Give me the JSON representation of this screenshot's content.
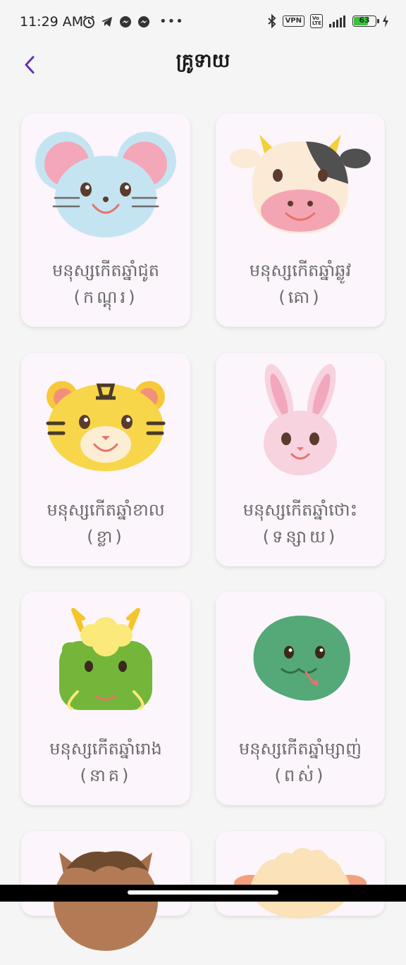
{
  "status": {
    "time": "11:29 AM",
    "battery": "63",
    "vpn": "VPN",
    "volte": "Vo LTE"
  },
  "header": {
    "title": "គ្រូទាយ"
  },
  "cards": [
    {
      "title": "មនុស្សកើតឆ្នាំជូត",
      "subtitle": "(កណ្ដុរ)",
      "icon": "rat-icon"
    },
    {
      "title": "មនុស្សកើតឆ្នាំឆ្លូវ",
      "subtitle": "(គោ)",
      "icon": "ox-icon"
    },
    {
      "title": "មនុស្សកើតឆ្នាំខាល",
      "subtitle": "(ខ្លា)",
      "icon": "tiger-icon"
    },
    {
      "title": "មនុស្សកើតឆ្នាំថោះ",
      "subtitle": "(ទន្សាយ)",
      "icon": "rabbit-icon"
    },
    {
      "title": "មនុស្សកើតឆ្នាំរោង",
      "subtitle": "(នាគ)",
      "icon": "dragon-icon"
    },
    {
      "title": "មនុស្សកើតឆ្នាំម្សាញ់",
      "subtitle": "(ពស់)",
      "icon": "snake-icon"
    },
    {
      "title": "",
      "subtitle": "",
      "icon": "horse-icon"
    },
    {
      "title": "",
      "subtitle": "",
      "icon": "goat-icon"
    }
  ],
  "colors": {
    "accent": "#5e35b1",
    "card_bg": "#fcf5fb",
    "page_bg": "#f5f5f5"
  }
}
